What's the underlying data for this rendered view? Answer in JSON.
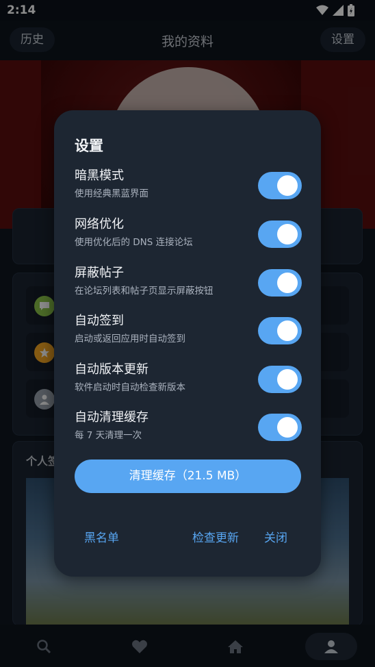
{
  "status_bar": {
    "time": "2:14",
    "icons": [
      "wifi-icon",
      "signal-icon",
      "battery-charging-icon"
    ]
  },
  "app_bar": {
    "history_label": "历史",
    "title": "我的资料",
    "settings_label": "设置"
  },
  "background": {
    "signature_title": "个人签",
    "list_icons": [
      "chat-bubble-icon",
      "star-icon",
      "user-icon"
    ],
    "list_icon_colors": [
      "#8bc34a",
      "#f5a623",
      "#9aa3ad"
    ]
  },
  "bottom_nav": {
    "items": [
      "search-icon",
      "heart-icon",
      "home-icon",
      "person-icon"
    ],
    "active": "person-icon"
  },
  "dialog": {
    "title": "设置",
    "settings": [
      {
        "title": "暗黑模式",
        "description": "使用经典黑蓝界面",
        "enabled": true
      },
      {
        "title": "网络优化",
        "description": "使用优化后的 DNS 连接论坛",
        "enabled": true
      },
      {
        "title": "屏蔽帖子",
        "description": "在论坛列表和帖子页显示屏蔽按钮",
        "enabled": true
      },
      {
        "title": "自动签到",
        "description": "启动或返回应用时自动签到",
        "enabled": true
      },
      {
        "title": "自动版本更新",
        "description": "软件启动时自动检查新版本",
        "enabled": true
      },
      {
        "title": "自动清理缓存",
        "description": "每 7 天清理一次",
        "enabled": true
      }
    ],
    "clear_cache_button": "清理缓存（21.5 MB）",
    "blacklist_button": "黑名单",
    "check_update_button": "检查更新",
    "close_button": "关闭"
  },
  "colors": {
    "accent": "#58a6f2",
    "dialog_bg": "#1d2632",
    "page_bg": "#0f1620"
  }
}
